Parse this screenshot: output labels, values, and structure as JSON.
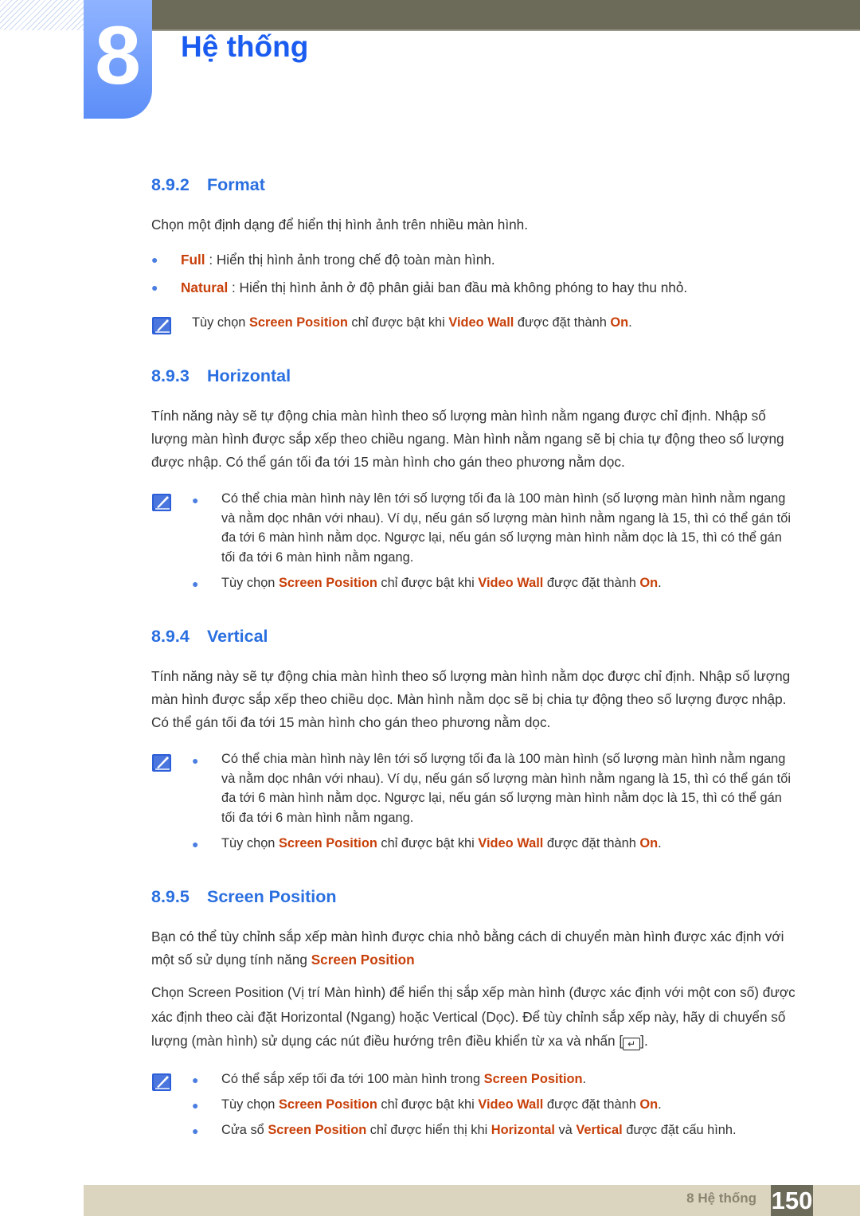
{
  "header": {
    "chapter_number": "8",
    "chapter_title": "Hệ thống"
  },
  "sections": [
    {
      "num": "8.9.2",
      "title": "Format",
      "intro": [
        {
          "t": "Chọn một định dạng để hiển thị hình ảnh trên nhiều màn hình."
        }
      ],
      "bullets": [
        [
          {
            "t": "Full",
            "h": 1
          },
          {
            "t": " : Hiển thị hình ảnh trong chế độ toàn màn hình."
          }
        ],
        [
          {
            "t": "Natural",
            "h": 1
          },
          {
            "t": " : Hiển thị hình ảnh ở độ phân giải ban đầu mà không phóng to hay thu nhỏ."
          }
        ]
      ],
      "note": [
        [
          {
            "t": "Tùy chọn "
          },
          {
            "t": "Screen Position",
            "h": 1
          },
          {
            "t": " chỉ được bật khi "
          },
          {
            "t": "Video Wall",
            "h": 1
          },
          {
            "t": " được đặt thành "
          },
          {
            "t": "On",
            "h": 1
          },
          {
            "t": "."
          }
        ]
      ]
    },
    {
      "num": "8.9.3",
      "title": "Horizontal",
      "intro": [
        {
          "t": "Tính năng này sẽ tự động chia màn hình theo số lượng màn hình nằm ngang được chỉ định. Nhập số lượng màn hình được sắp xếp theo chiều ngang. Màn hình nằm ngang sẽ bị chia tự động theo số lượng được nhập. Có thể gán tối đa tới 15 màn hình cho gán theo phương nằm dọc."
        }
      ],
      "note": [
        [
          {
            "t": "Có thể chia màn hình này lên tới số lượng tối đa là 100 màn hình (số lượng màn hình nằm ngang và nằm dọc nhân với nhau). Ví dụ, nếu gán số lượng màn hình nằm ngang là 15, thì có thể gán tối đa tới 6 màn hình nằm dọc. Ngược lại, nếu gán số lượng màn hình nằm dọc là 15, thì có thể gán tối đa tới 6 màn hình nằm ngang."
          }
        ],
        [
          {
            "t": "Tùy chọn "
          },
          {
            "t": "Screen Position",
            "h": 1
          },
          {
            "t": " chỉ được bật khi "
          },
          {
            "t": "Video Wall",
            "h": 1
          },
          {
            "t": " được đặt thành "
          },
          {
            "t": "On",
            "h": 1
          },
          {
            "t": "."
          }
        ]
      ]
    },
    {
      "num": "8.9.4",
      "title": "Vertical",
      "intro": [
        {
          "t": "Tính năng này sẽ tự động chia màn hình theo số lượng màn hình nằm dọc được chỉ định. Nhập số lượng màn hình được sắp xếp theo chiều dọc. Màn hình nằm dọc sẽ bị chia tự động theo số lượng được nhập. Có thể gán tối đa tới 15 màn hình cho gán theo phương nằm dọc."
        }
      ],
      "note": [
        [
          {
            "t": "Có thể chia màn hình này lên tới số lượng tối đa là 100 màn hình (số lượng màn hình nằm ngang và nằm dọc nhân với nhau). Ví dụ, nếu gán số lượng màn hình nằm ngang là 15, thì có thể gán tối đa tới 6 màn hình nằm dọc. Ngược lại, nếu gán số lượng màn hình nằm dọc là 15, thì có thể gán tối đa tới 6 màn hình nằm ngang."
          }
        ],
        [
          {
            "t": "Tùy chọn "
          },
          {
            "t": "Screen Position",
            "h": 1
          },
          {
            "t": " chỉ được bật khi "
          },
          {
            "t": "Video Wall",
            "h": 1
          },
          {
            "t": " được đặt thành "
          },
          {
            "t": "On",
            "h": 1
          },
          {
            "t": "."
          }
        ]
      ]
    },
    {
      "num": "8.9.5",
      "title": "Screen Position",
      "intro": [
        {
          "t": "Bạn có thể tùy chỉnh sắp xếp màn hình được chia nhỏ bằng cách di chuyển màn hình được xác định với một số sử dụng tính năng "
        },
        {
          "t": "Screen Position",
          "h": 1
        }
      ],
      "intro2": [
        {
          "t": "Chọn Screen Position (Vị trí Màn hình) để hiển thị sắp xếp màn hình (được xác định với một con số) được xác định theo cài đặt Horizontal (Ngang) hoặc Vertical (Dọc). Để tùy chỉnh sắp xếp này, hãy di chuyển số lượng (màn hình) sử dụng các nút điều hướng trên điều khiển từ xa và nhấn ["
        },
        {
          "icon": "enter-icon"
        },
        {
          "t": "]."
        }
      ],
      "note": [
        [
          {
            "t": "Có thể sắp xếp tối đa tới 100 màn hình trong "
          },
          {
            "t": "Screen Position",
            "h": 1
          },
          {
            "t": "."
          }
        ],
        [
          {
            "t": "Tùy chọn "
          },
          {
            "t": "Screen Position",
            "h": 1
          },
          {
            "t": " chỉ được bật khi "
          },
          {
            "t": "Video Wall",
            "h": 1
          },
          {
            "t": " được đặt thành "
          },
          {
            "t": "On",
            "h": 1
          },
          {
            "t": "."
          }
        ],
        [
          {
            "t": "Cửa sổ "
          },
          {
            "t": "Screen Position",
            "h": 1
          },
          {
            "t": " chỉ được hiển thị khi "
          },
          {
            "t": "Horizontal",
            "h": 1
          },
          {
            "t": " và "
          },
          {
            "t": "Vertical",
            "h": 1
          },
          {
            "t": " được đặt cấu hình."
          }
        ]
      ]
    }
  ],
  "footer": {
    "label": "8 Hệ thống",
    "page": "150"
  },
  "colors": {
    "heading": "#2a6fe0",
    "highlight": "#c8400a",
    "footer_bg": "#dbd5bf"
  }
}
